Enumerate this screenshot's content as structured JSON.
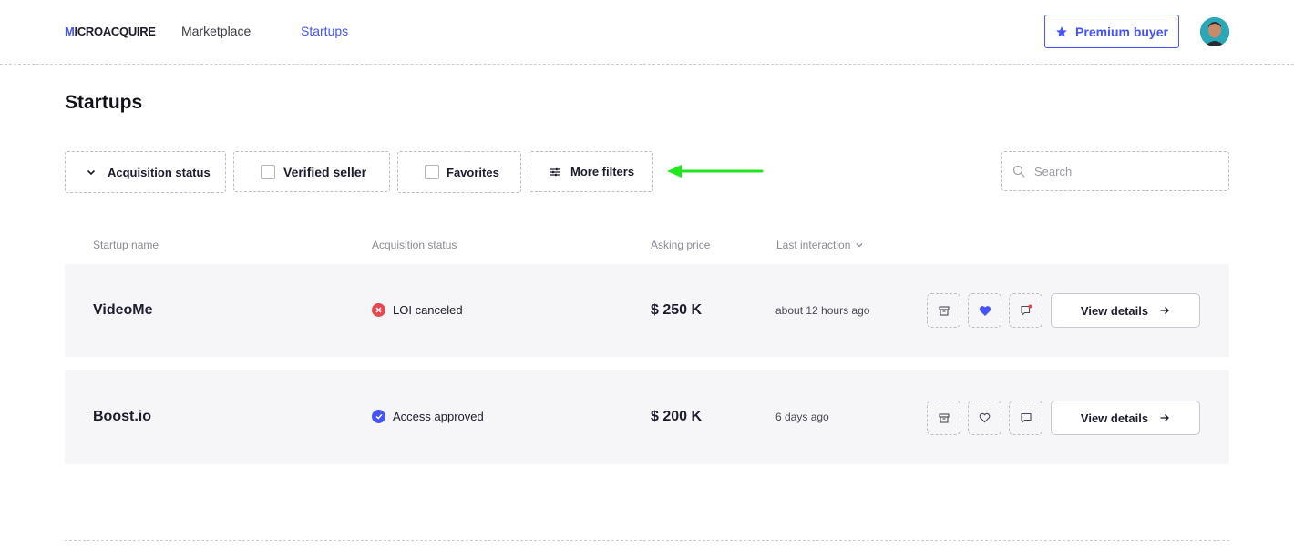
{
  "header": {
    "logo": {
      "first_letter": "M",
      "rest": "ICROACQUIRE"
    },
    "nav": [
      {
        "label": "Marketplace"
      },
      {
        "label": "Startups"
      }
    ],
    "premium_label": "Premium buyer",
    "accent_color": "#4353ff"
  },
  "page": {
    "title": "Startups"
  },
  "filters": {
    "acquisition_status": "Acquisition status",
    "verified_seller": "Verified seller",
    "favorites": "Favorites",
    "more_filters": "More filters"
  },
  "annotation": {
    "arrow_color": "#1fe81f"
  },
  "search": {
    "placeholder": "Search"
  },
  "table": {
    "headers": {
      "name": "Startup name",
      "acquisition": "Acquisition status",
      "price": "Asking price",
      "last": "Last interaction"
    },
    "rows": [
      {
        "name": "VideoMe",
        "status": "LOI canceled",
        "status_icon": "x-circle-icon",
        "status_color": "#e5484d",
        "price": "$ 250 K",
        "last": "about 12 hours ago",
        "favorited": true,
        "has_message_badge": true,
        "view_label": "View details"
      },
      {
        "name": "Boost.io",
        "status": "Access approved",
        "status_icon": "check-circle-icon",
        "status_color": "#4353ff",
        "price": "$ 200 K",
        "last": "6 days ago",
        "favorited": false,
        "has_message_badge": false,
        "view_label": "View details"
      }
    ]
  }
}
